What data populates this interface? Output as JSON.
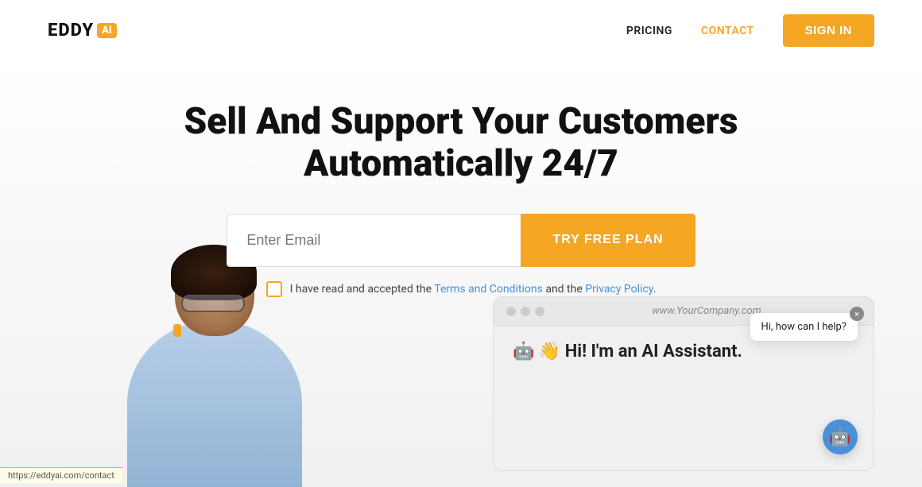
{
  "navbar": {
    "logo_text": "EDDY",
    "logo_badge": "AI",
    "pricing_label": "PRICING",
    "contact_label": "CONTACT",
    "signin_label": "SIGN IN"
  },
  "hero": {
    "title_line1": "Sell And Support Your Customers",
    "title_line2": "Automatically 24/7",
    "email_placeholder": "Enter Email",
    "cta_label": "TRY FREE PLAN",
    "checkbox_text_pre": "I have read and accepted the ",
    "checkbox_text_mid": "Terms and Conditions",
    "checkbox_text_and": " and the ",
    "checkbox_text_link": "Privacy Policy",
    "checkbox_text_post": "."
  },
  "browser": {
    "url": "www.YourCompany.com",
    "greeting": "🤖 👋 Hi! I'm an AI Assistant."
  },
  "chat": {
    "popup_text": "Hi, how can I help?",
    "close_label": "×"
  },
  "status_bar": {
    "url": "https://eddyai.com/contact"
  },
  "colors": {
    "accent": "#f5a623",
    "blue_link": "#4a90d9"
  }
}
